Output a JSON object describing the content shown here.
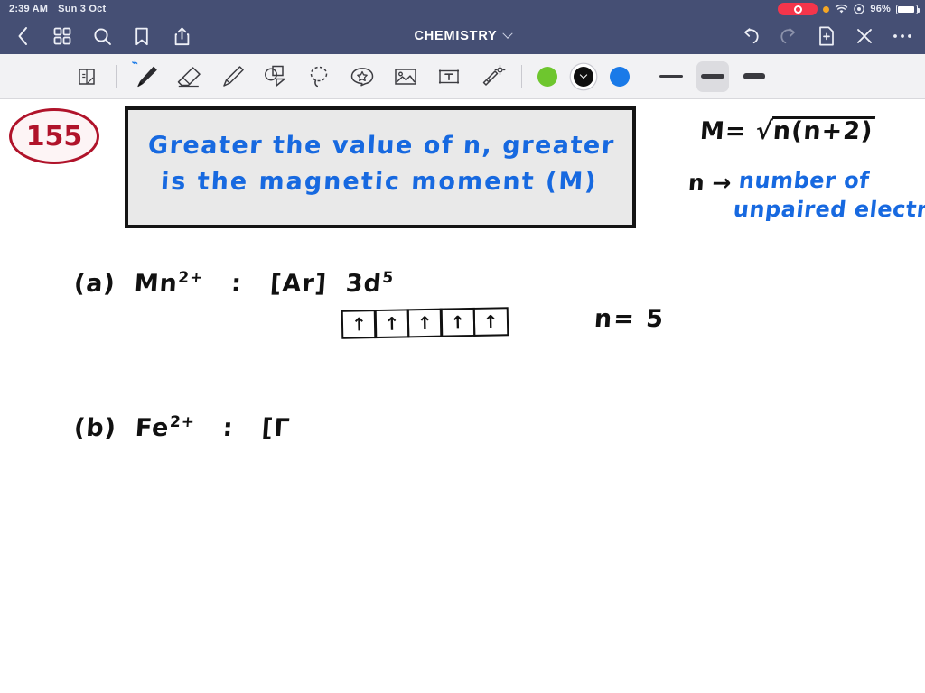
{
  "status_bar": {
    "time": "2:39 AM",
    "date": "Sun 3 Oct",
    "battery_percent": "96%",
    "recording_indicator": "recording-pill",
    "icons": [
      "orange-privacy-dot",
      "wifi-icon",
      "screen-record-icon",
      "battery-icon"
    ]
  },
  "nav_bar": {
    "title": "CHEMISTRY",
    "left_icons": [
      "back-chevron-icon",
      "grid-icon",
      "search-icon",
      "bookmark-icon",
      "share-icon"
    ],
    "right_icons": [
      "undo-icon",
      "redo-icon",
      "add-page-icon",
      "close-icon",
      "more-icon"
    ]
  },
  "toolbar": {
    "tools": [
      {
        "name": "page-tool",
        "glyph": "page"
      },
      {
        "name": "pen-tool",
        "glyph": "pen",
        "selected": true,
        "badge": "bluetooth"
      },
      {
        "name": "eraser-tool",
        "glyph": "eraser"
      },
      {
        "name": "highlighter-tool",
        "glyph": "highlighter"
      },
      {
        "name": "shapes-tool",
        "glyph": "shapes"
      },
      {
        "name": "lasso-tool",
        "glyph": "lasso"
      },
      {
        "name": "sticker-tool",
        "glyph": "sticker"
      },
      {
        "name": "image-tool",
        "glyph": "image"
      },
      {
        "name": "text-box-tool",
        "glyph": "textbox"
      },
      {
        "name": "magic-wand-tool",
        "glyph": "wand"
      }
    ],
    "colors": [
      {
        "name": "green-swatch",
        "hex": "#6ec62e",
        "selected": false
      },
      {
        "name": "black-swatch",
        "hex": "#0f0f0f",
        "selected": true
      },
      {
        "name": "blue-swatch",
        "hex": "#1a7ae8",
        "selected": false
      }
    ],
    "stroke_widths": [
      {
        "name": "thin-stroke",
        "thickness": 3,
        "width": 26,
        "selected": false
      },
      {
        "name": "medium-stroke",
        "thickness": 5,
        "width": 26,
        "selected": true
      },
      {
        "name": "thick-stroke",
        "thickness": 7,
        "width": 24,
        "selected": false
      }
    ]
  },
  "notes": {
    "page_badge": "155",
    "highlight_box": {
      "line1": "Greater the value of n, greater",
      "line2": "is the  magnetic moment (Μ)"
    },
    "formula": {
      "lhs": "Μ=",
      "radicand": "n(n+2)"
    },
    "legend": {
      "symbol": "n →",
      "line1": "number of",
      "line2": "unpaired electrons"
    },
    "part_a": {
      "label": "(a)",
      "species": "Mn",
      "charge": "2+",
      "colon": ":",
      "config_core": "[Ar]",
      "config_orbital": "3d",
      "config_exponent": "5",
      "orbital_boxes": [
        "↑",
        "↑",
        "↑",
        "↑",
        "↑"
      ],
      "n_value": "n= 5"
    },
    "part_b": {
      "label": "(b)",
      "species": "Fe",
      "charge": "2+",
      "colon": ":",
      "config_partial": "[Γ"
    }
  }
}
